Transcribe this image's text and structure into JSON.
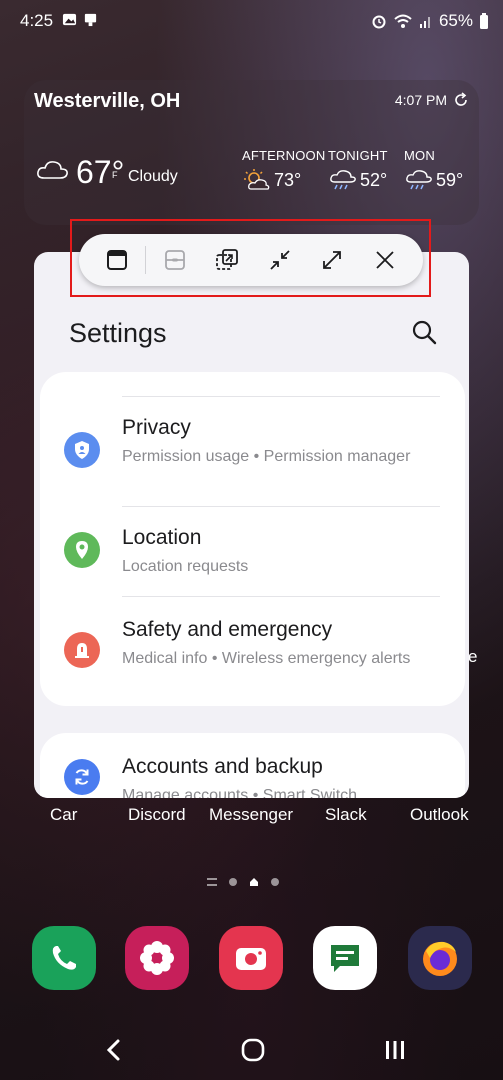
{
  "status_bar": {
    "time": "4:25",
    "battery": "65%",
    "left_icons": [
      "image-icon",
      "cast-icon"
    ],
    "right_icons": [
      "alarm-icon",
      "wifi-icon",
      "signal-icon",
      "battery-icon"
    ]
  },
  "weather": {
    "city": "Westerville, OH",
    "updated": "4:07 PM",
    "temp": "67°",
    "unit": "F",
    "condition": "Cloudy",
    "forecast": [
      {
        "label": "AFTERNOON",
        "temp": "73°",
        "icon": "sun-cloud-icon"
      },
      {
        "label": "TONIGHT",
        "temp": "52°",
        "icon": "rain-cloud-icon"
      },
      {
        "label": "MON",
        "temp": "59°",
        "icon": "rain-cloud-icon"
      }
    ]
  },
  "toolbar": {
    "buttons": [
      "window-icon",
      "split-icon",
      "pip-icon",
      "minimize-icon",
      "maximize-icon",
      "close-icon"
    ]
  },
  "settings": {
    "title": "Settings",
    "partial_top": "···",
    "items": [
      {
        "title": "Privacy",
        "subtitle": "Permission usage  •  Permission manager",
        "icon": "shield-icon",
        "color": "#5b8def"
      },
      {
        "title": "Location",
        "subtitle": "Location requests",
        "icon": "location-pin-icon",
        "color": "#5fb95a"
      },
      {
        "title": "Safety and emergency",
        "subtitle": "Medical info  •  Wireless emergency alerts",
        "icon": "siren-icon",
        "color": "#ec6656"
      },
      {
        "title": "Accounts and backup",
        "subtitle": "Manage accounts  •  Smart Switch",
        "icon": "sync-icon",
        "color": "#4a7cf0"
      }
    ]
  },
  "apps_row": [
    {
      "label": "Car"
    },
    {
      "label": "Discord"
    },
    {
      "label": "Messenger"
    },
    {
      "label": "Slack"
    },
    {
      "label": "Outlook"
    }
  ],
  "edge_label": "e",
  "dock": [
    {
      "name": "phone",
      "color": "#1aa25a"
    },
    {
      "name": "gallery",
      "color": "#c61f5a"
    },
    {
      "name": "camera",
      "color": "#e4354f"
    },
    {
      "name": "messages",
      "color": "#ffffff"
    },
    {
      "name": "firefox",
      "color": "#2b2a4d"
    }
  ],
  "accent_highlight": "#e31a1a"
}
